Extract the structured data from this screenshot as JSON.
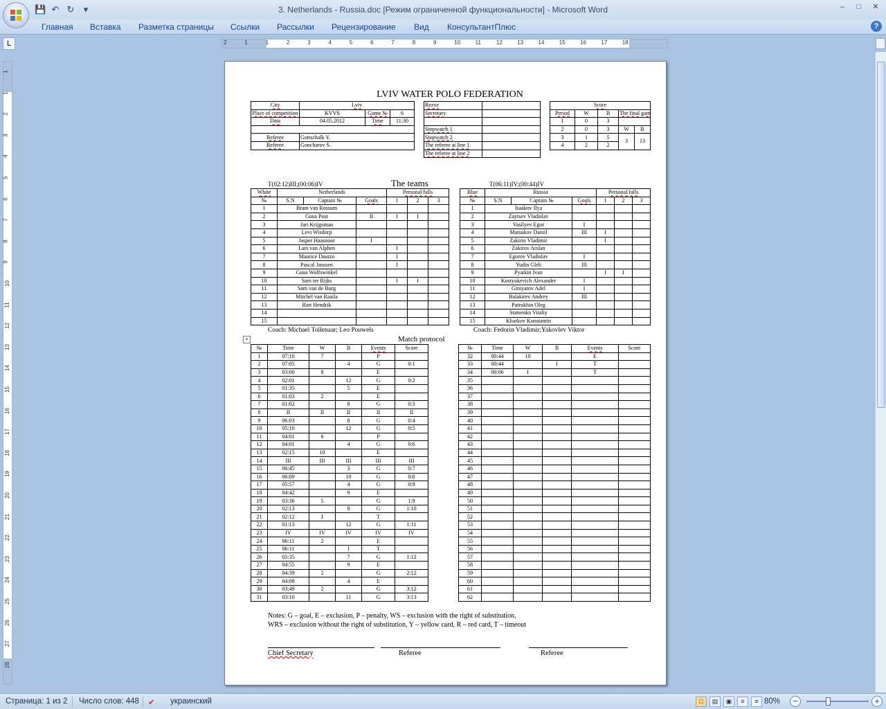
{
  "window": {
    "title": "3. Netherlands - Russia.doc [Режим ограниченной функциональности] - Microsoft Word"
  },
  "ribbon": {
    "tabs": [
      "Главная",
      "Вставка",
      "Разметка страницы",
      "Ссылки",
      "Рассылки",
      "Рецензирование",
      "Вид",
      "КонсультантПлюс"
    ]
  },
  "ruler": {
    "h_numbers": [
      "2",
      "1",
      "1",
      "2",
      "3",
      "4",
      "5",
      "6",
      "7",
      "8",
      "9",
      "10",
      "11",
      "12",
      "13",
      "14",
      "15",
      "16",
      "17",
      "18"
    ],
    "v_numbers": [
      "1",
      "1",
      "2",
      "3",
      "4",
      "5",
      "6",
      "7",
      "8",
      "9",
      "10",
      "11",
      "12",
      "13",
      "14",
      "15",
      "16",
      "17",
      "18",
      "19",
      "20",
      "21",
      "22",
      "23",
      "24",
      "25",
      "26",
      "27",
      "28"
    ]
  },
  "status": {
    "page": "Страница: 1 из 2",
    "words": "Число слов: 448",
    "language": "украинский",
    "zoom": "80%"
  },
  "doc": {
    "title": "LVIV WATER POLO FEDERATION",
    "info": {
      "rows": [
        [
          "City",
          "Lviv",
          "",
          ""
        ],
        [
          "Place of competition",
          "KVVS",
          "Game №",
          "6"
        ],
        [
          "Data",
          "04.05.2012",
          "Time",
          "11:30"
        ],
        [
          "",
          "",
          "",
          ""
        ],
        [
          "Referee",
          "Gottschalk Y.",
          "",
          ""
        ],
        [
          "Referee",
          "Goncharov S.",
          "",
          ""
        ]
      ]
    },
    "officials": {
      "rows": [
        [
          "Rezve",
          ""
        ],
        [
          "Secretary",
          ""
        ],
        [
          "",
          ""
        ],
        [
          "Stopwatch 1",
          ""
        ],
        [
          "Stopwatch 2",
          ""
        ],
        [
          "The referee at line 1",
          ""
        ],
        [
          "The referee at line 2",
          ""
        ]
      ]
    },
    "score": {
      "header": "Score",
      "cols": [
        "Period",
        "W",
        "B",
        "The final game score"
      ],
      "wb": [
        "W",
        "B"
      ],
      "periods": [
        [
          "1",
          "0",
          "3"
        ],
        [
          "2",
          "0",
          "3"
        ],
        [
          "3",
          "1",
          "5"
        ],
        [
          "4",
          "2",
          "2"
        ]
      ],
      "final": [
        "3",
        "13"
      ]
    },
    "teams_heading": "The teams",
    "timeouts_left": "T(02:12)III;(00:06)IV",
    "timeouts_right": "T(06:11)IV;(00:44)IV",
    "team_left": {
      "color": "White",
      "name": "Netherlands",
      "pf": "Personal falls",
      "cols": [
        "№",
        "S.N",
        "Captain №",
        "Goals",
        "1",
        "2",
        "3"
      ],
      "players": [
        [
          "1",
          "Bram van Rossum",
          "",
          "",
          "",
          ""
        ],
        [
          "2",
          "Guus Post",
          "II",
          "I",
          "I",
          ""
        ],
        [
          "3",
          "Jari Krijgsman",
          "",
          "",
          "",
          ""
        ],
        [
          "4",
          "Levi Wisdorp",
          "",
          "",
          "",
          ""
        ],
        [
          "5",
          "Jasper Haasnoot",
          "I",
          "",
          "",
          ""
        ],
        [
          "6",
          "Lars van Alphen",
          "",
          "I",
          "",
          ""
        ],
        [
          "7",
          "Maurice Dautzo",
          "",
          "I",
          "",
          ""
        ],
        [
          "8",
          "Pascal Janssen",
          "",
          "I",
          "",
          ""
        ],
        [
          "9",
          "Guus Wolfswinkel",
          "",
          "",
          "",
          ""
        ],
        [
          "10",
          "Sam ter Rijks",
          "",
          "I",
          "I",
          ""
        ],
        [
          "11",
          "Sam van de Burg",
          "",
          "",
          "",
          ""
        ],
        [
          "12",
          "Mitchel van Raaila",
          "",
          "",
          "",
          ""
        ],
        [
          "13",
          "Bart Hendrik",
          "",
          "",
          "",
          ""
        ],
        [
          "14",
          "",
          "",
          "",
          "",
          ""
        ],
        [
          "15",
          "",
          "",
          "",
          "",
          ""
        ]
      ],
      "coach": "Coach:  Michael Tollenaar; Leo Pouwels"
    },
    "team_right": {
      "color": "Blue",
      "name": "Russia",
      "pf": "Personal falls",
      "cols": [
        "№",
        "S.N",
        "Captain №",
        "Goals",
        "1",
        "2",
        "3"
      ],
      "players": [
        [
          "1",
          "Isaakov Ilya",
          "",
          "",
          "",
          ""
        ],
        [
          "2",
          "Zaytsev Vladislav",
          "",
          "",
          "",
          ""
        ],
        [
          "3",
          "Vasilyev Egor",
          "I",
          "",
          "",
          ""
        ],
        [
          "4",
          "Matsukov Daniil",
          "III",
          "I",
          "",
          ""
        ],
        [
          "5",
          "Zakirin Vladimir",
          "",
          "I",
          "",
          ""
        ],
        [
          "6",
          "Zakirov Arslan",
          "",
          "",
          "",
          ""
        ],
        [
          "7",
          "Egorov Vladislav",
          "I",
          "",
          "",
          ""
        ],
        [
          "8",
          "Yudin Gleb",
          "III",
          "",
          "",
          ""
        ],
        [
          "9",
          "Pyatkin Ivan",
          "",
          "I",
          "I",
          ""
        ],
        [
          "10",
          "Kostyukevich Alexander",
          "I",
          "",
          "",
          ""
        ],
        [
          "11",
          "Giniyatov Adel",
          "I",
          "",
          "",
          ""
        ],
        [
          "12",
          "Balakirev Andrey",
          "III",
          "",
          "",
          ""
        ],
        [
          "13",
          "Patrukhin Oleg",
          "",
          "",
          "",
          ""
        ],
        [
          "14",
          "Statsenko Vitaliy",
          "",
          "",
          "",
          ""
        ],
        [
          "15",
          "Kharkov Konstantin",
          "",
          "",
          "",
          ""
        ]
      ],
      "coach": "Coach: Fedorin Vladimir;Yakovlev Viktor"
    },
    "protocol_heading": "Match protocol",
    "protocol_cols": [
      "№",
      "Time",
      "W",
      "B",
      "Events",
      "Score"
    ],
    "protocol_left": [
      [
        "1",
        "07:10",
        "7",
        "",
        "P",
        ""
      ],
      [
        "2",
        "07:05",
        "",
        "4",
        "G",
        "0:1"
      ],
      [
        "3",
        "03:00",
        "8",
        "",
        "E",
        ""
      ],
      [
        "4",
        "02:01",
        "",
        "12",
        "G",
        "0:2"
      ],
      [
        "5",
        "01:35",
        "",
        "5",
        "E",
        ""
      ],
      [
        "6",
        "01:03",
        "2",
        "",
        "E",
        ""
      ],
      [
        "7",
        "01:02",
        "",
        "8",
        "G",
        "0:3"
      ],
      [
        "8",
        "II",
        "II",
        "II",
        "II",
        "II"
      ],
      [
        "9",
        "06:03",
        "",
        "8",
        "G",
        "0:4"
      ],
      [
        "10",
        "05:10",
        "",
        "12",
        "G",
        "0:5"
      ],
      [
        "11",
        "04:01",
        "6",
        "",
        "P",
        ""
      ],
      [
        "12",
        "04:01",
        "",
        "4",
        "G",
        "0:6"
      ],
      [
        "13",
        "02:15",
        "10",
        "",
        "E",
        ""
      ],
      [
        "14",
        "III",
        "III",
        "III",
        "III",
        "III"
      ],
      [
        "15",
        "06:45",
        "",
        "3",
        "G",
        "0:7"
      ],
      [
        "16",
        "06:09",
        "",
        "10",
        "G",
        "0:8"
      ],
      [
        "17",
        "05:57",
        "",
        "4",
        "G",
        "0:9"
      ],
      [
        "18",
        "04:42",
        "",
        "9",
        "E",
        ""
      ],
      [
        "19",
        "03:36",
        "5",
        "",
        "G",
        "1:9"
      ],
      [
        "20",
        "02:13",
        "",
        "8",
        "G",
        "1:10"
      ],
      [
        "21",
        "02:12",
        "I",
        "",
        "T",
        ""
      ],
      [
        "22",
        "01:13",
        "",
        "12",
        "G",
        "1:11"
      ],
      [
        "23",
        "IV",
        "IV",
        "IV",
        "IV",
        "IV"
      ],
      [
        "24",
        "06:11",
        "2",
        "",
        "E",
        ""
      ],
      [
        "25",
        "06:11",
        "",
        "I",
        "T",
        ""
      ],
      [
        "26",
        "05:35",
        "",
        "7",
        "G",
        "1:12"
      ],
      [
        "27",
        "04:55",
        "",
        "9",
        "E",
        ""
      ],
      [
        "28",
        "04:39",
        "2",
        "",
        "G",
        "2:12"
      ],
      [
        "29",
        "04:08",
        "",
        "4",
        "E",
        ""
      ],
      [
        "30",
        "03:49",
        "2",
        "",
        "G",
        "3:12"
      ],
      [
        "31",
        "03:10",
        "",
        "11",
        "G",
        "3:13"
      ]
    ],
    "protocol_right": [
      [
        "32",
        "00:44",
        "10",
        "",
        "E",
        ""
      ],
      [
        "33",
        "00:44",
        "",
        "I",
        "T",
        ""
      ],
      [
        "34",
        "00:06",
        "I",
        "",
        "T",
        ""
      ],
      [
        "35",
        "",
        "",
        "",
        "",
        ""
      ],
      [
        "36",
        "",
        "",
        "",
        "",
        ""
      ],
      [
        "37",
        "",
        "",
        "",
        "",
        ""
      ],
      [
        "38",
        "",
        "",
        "",
        "",
        ""
      ],
      [
        "39",
        "",
        "",
        "",
        "",
        ""
      ],
      [
        "40",
        "",
        "",
        "",
        "",
        ""
      ],
      [
        "41",
        "",
        "",
        "",
        "",
        ""
      ],
      [
        "42",
        "",
        "",
        "",
        "",
        ""
      ],
      [
        "43",
        "",
        "",
        "",
        "",
        ""
      ],
      [
        "44",
        "",
        "",
        "",
        "",
        ""
      ],
      [
        "45",
        "",
        "",
        "",
        "",
        ""
      ],
      [
        "46",
        "",
        "",
        "",
        "",
        ""
      ],
      [
        "47",
        "",
        "",
        "",
        "",
        ""
      ],
      [
        "48",
        "",
        "",
        "",
        "",
        ""
      ],
      [
        "49",
        "",
        "",
        "",
        "",
        ""
      ],
      [
        "50",
        "",
        "",
        "",
        "",
        ""
      ],
      [
        "51",
        "",
        "",
        "",
        "",
        ""
      ],
      [
        "52",
        "",
        "",
        "",
        "",
        ""
      ],
      [
        "53",
        "",
        "",
        "",
        "",
        ""
      ],
      [
        "54",
        "",
        "",
        "",
        "",
        ""
      ],
      [
        "55",
        "",
        "",
        "",
        "",
        ""
      ],
      [
        "56",
        "",
        "",
        "",
        "",
        ""
      ],
      [
        "57",
        "",
        "",
        "",
        "",
        ""
      ],
      [
        "58",
        "",
        "",
        "",
        "",
        ""
      ],
      [
        "59",
        "",
        "",
        "",
        "",
        ""
      ],
      [
        "60",
        "",
        "",
        "",
        "",
        ""
      ],
      [
        "61",
        "",
        "",
        "",
        "",
        ""
      ],
      [
        "62",
        "",
        "",
        "",
        "",
        ""
      ]
    ],
    "notes_line1": "Notes: G – goal, E – exclusion, P – penalty, WS – exclusion with the right of substitution,",
    "notes_line2": "WRS – exclusion without the right of substitution, Y – yellow card,  R – red card, T – timeout",
    "sig_chief": "Chief Secretary",
    "sig_ref1": "Referee",
    "sig_ref2": "Referee"
  }
}
